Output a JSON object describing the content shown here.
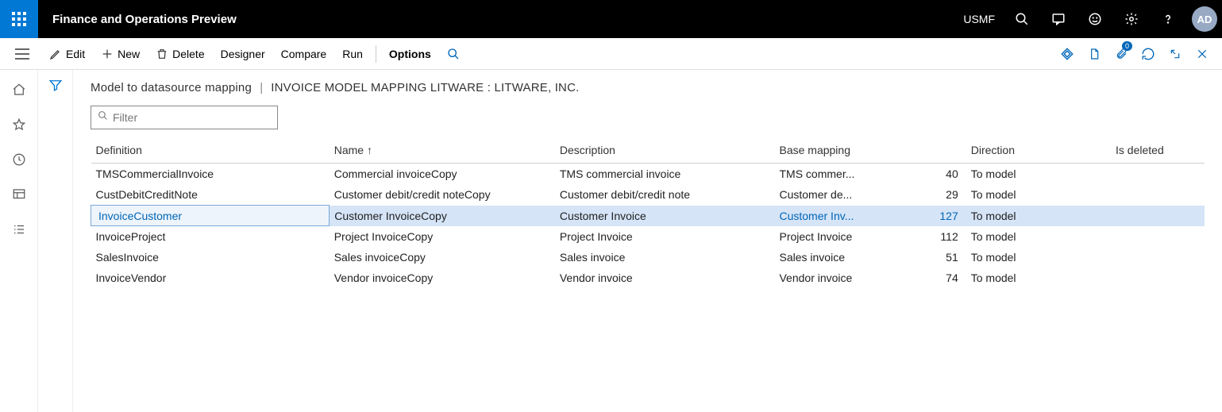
{
  "header": {
    "app_title": "Finance and Operations Preview",
    "company": "USMF",
    "avatar": "AD"
  },
  "actions": {
    "edit": "Edit",
    "new": "New",
    "delete": "Delete",
    "designer": "Designer",
    "compare": "Compare",
    "run": "Run",
    "options": "Options"
  },
  "breadcrumb": {
    "a": "Model to datasource mapping",
    "b": "INVOICE MODEL MAPPING LITWARE : LITWARE, INC."
  },
  "filter": {
    "placeholder": "Filter"
  },
  "columns": {
    "definition": "Definition",
    "name": "Name",
    "description": "Description",
    "base": "Base mapping",
    "dir": "Direction",
    "del": "Is deleted"
  },
  "rows": [
    {
      "def": "TMSCommercialInvoice",
      "name": "Commercial invoiceCopy",
      "desc": "TMS commercial invoice",
      "base": "TMS commer...",
      "num": "40",
      "dir": "To model",
      "sel": false
    },
    {
      "def": "CustDebitCreditNote",
      "name": "Customer debit/credit noteCopy",
      "desc": "Customer debit/credit note",
      "base": "Customer de...",
      "num": "29",
      "dir": "To model",
      "sel": false
    },
    {
      "def": "InvoiceCustomer",
      "name": "Customer InvoiceCopy",
      "desc": "Customer Invoice",
      "base": "Customer Inv...",
      "num": "127",
      "dir": "To model",
      "sel": true
    },
    {
      "def": "InvoiceProject",
      "name": "Project InvoiceCopy",
      "desc": "Project Invoice",
      "base": "Project Invoice",
      "num": "112",
      "dir": "To model",
      "sel": false
    },
    {
      "def": "SalesInvoice",
      "name": "Sales invoiceCopy",
      "desc": "Sales invoice",
      "base": "Sales invoice",
      "num": "51",
      "dir": "To model",
      "sel": false
    },
    {
      "def": "InvoiceVendor",
      "name": "Vendor invoiceCopy",
      "desc": "Vendor invoice",
      "base": "Vendor invoice",
      "num": "74",
      "dir": "To model",
      "sel": false
    }
  ]
}
